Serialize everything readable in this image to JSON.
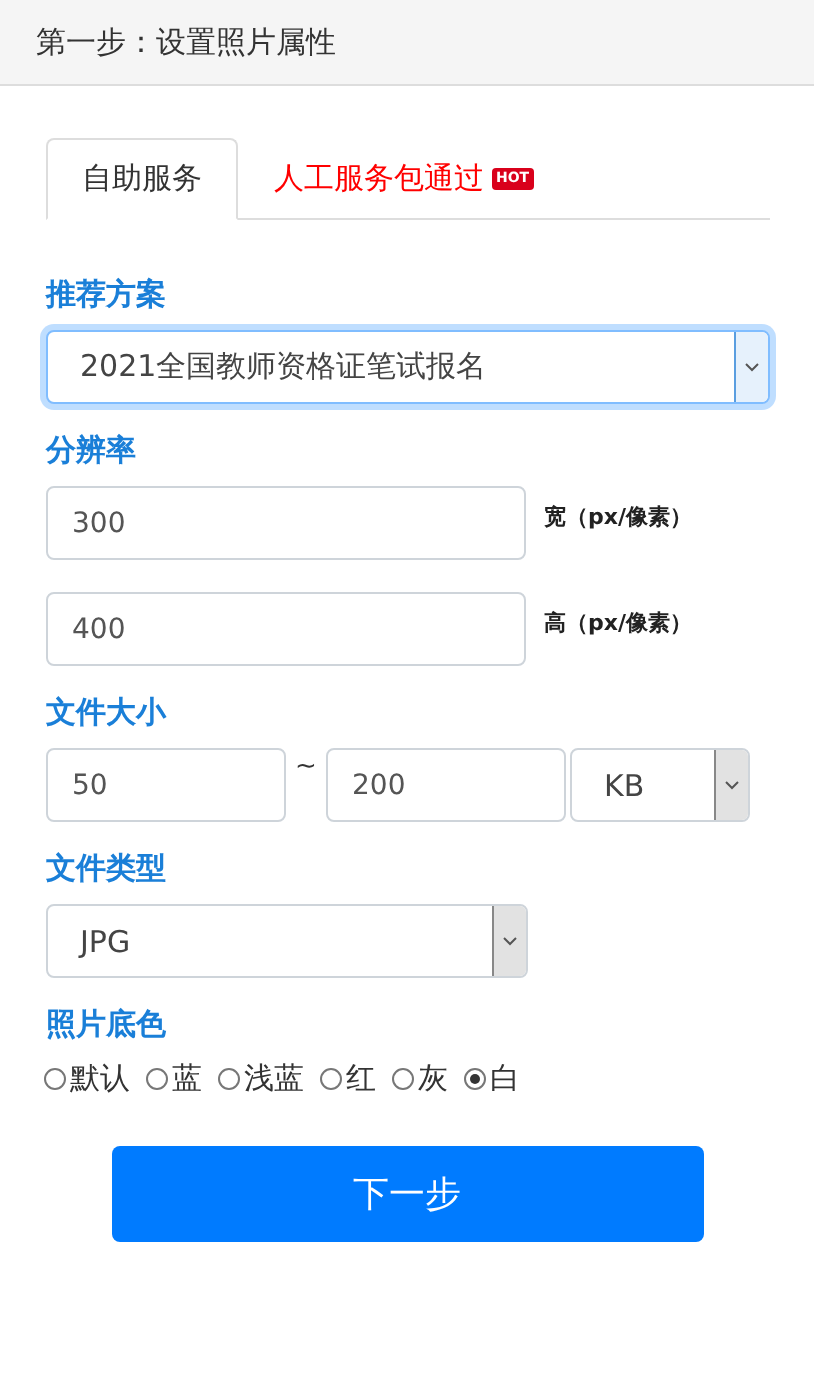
{
  "header": {
    "title": "第一步：设置照片属性"
  },
  "tabs": [
    {
      "label": "自助服务",
      "selected": true
    },
    {
      "label": "人工服务包通过",
      "selected": false,
      "badge": "HOT"
    }
  ],
  "recommend": {
    "label": "推荐方案",
    "value": "2021全国教师资格证笔试报名",
    "focused": true
  },
  "resolution": {
    "label": "分辨率",
    "fields": [
      {
        "value": "300",
        "unit": "宽（px/像素）"
      },
      {
        "value": "400",
        "unit": "高（px/像素）"
      }
    ]
  },
  "file_size": {
    "label": "文件大小",
    "min": "50",
    "separator": "~",
    "max": "200",
    "unit": "KB"
  },
  "file_type": {
    "label": "文件类型",
    "value": "JPG"
  },
  "background": {
    "label": "照片底色",
    "options": [
      {
        "label": "默认",
        "selected": false
      },
      {
        "label": "蓝",
        "selected": false
      },
      {
        "label": "浅蓝",
        "selected": false
      },
      {
        "label": "红",
        "selected": false
      },
      {
        "label": "灰",
        "selected": false
      },
      {
        "label": "白",
        "selected": true
      }
    ]
  },
  "next_button": "下一步"
}
